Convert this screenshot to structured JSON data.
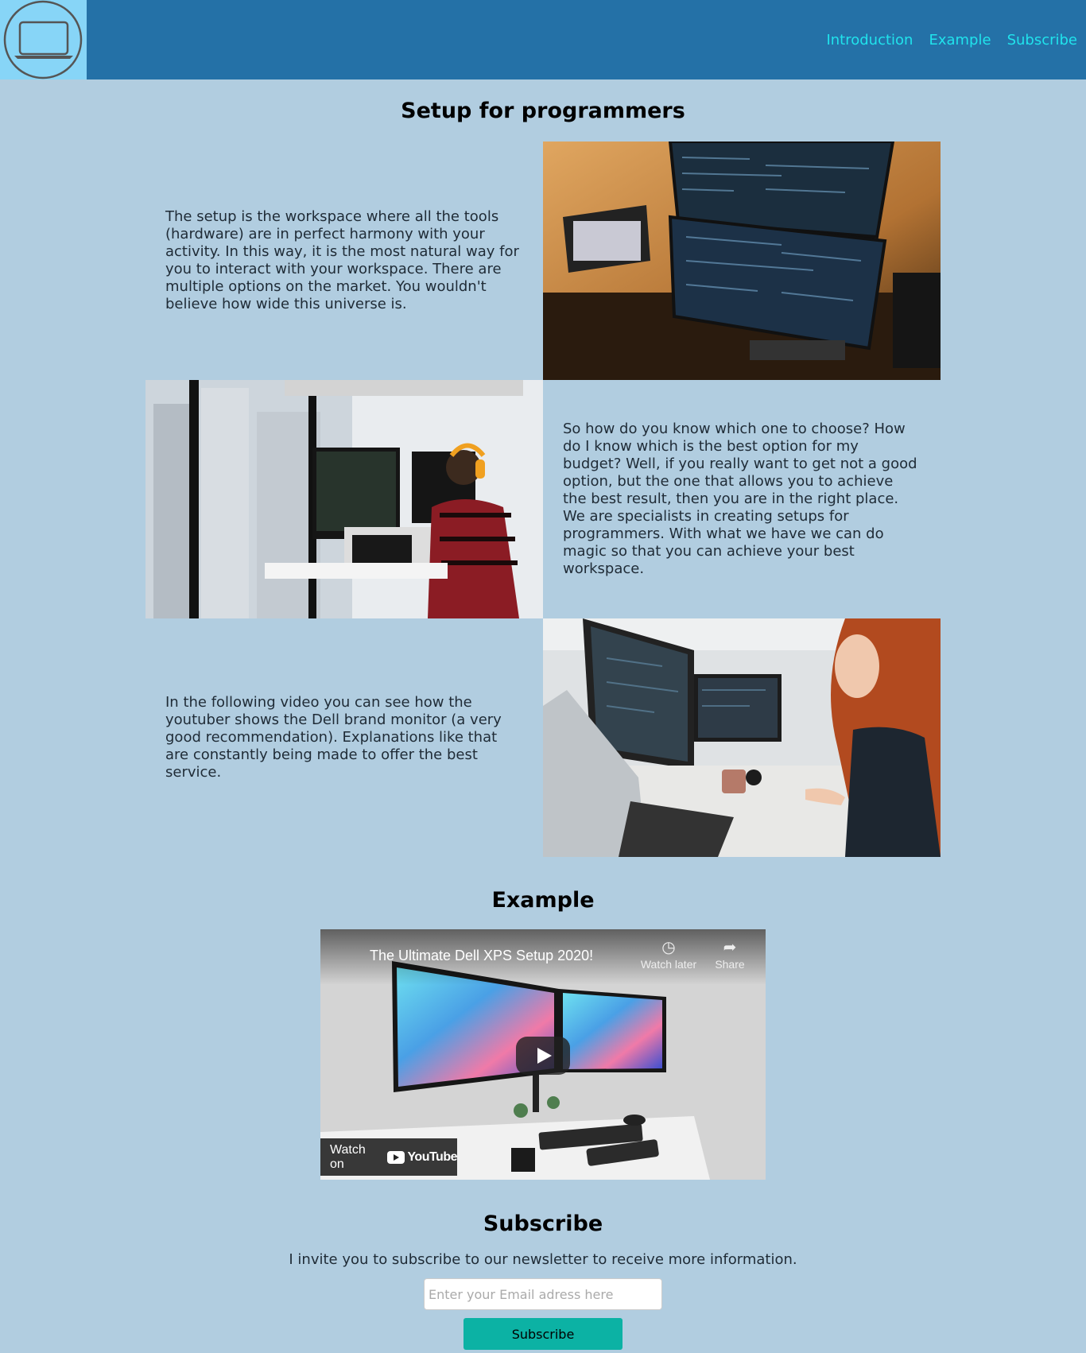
{
  "nav": {
    "logo_icon": "laptop-icon",
    "items": [
      "Introduction",
      "Example",
      "Subscribe"
    ]
  },
  "main": {
    "title": "Setup for programmers",
    "paragraphs": [
      "The setup is the workspace where all the tools (hardware) are in perfect harmony with your activity. In this way, it is the most natural way for you to interact with your workspace. There are multiple options on the market. You wouldn't believe how wide this universe is.",
      "So how do you know which one to choose? How do I know which is the best option for my budget? Well, if you really want to get not a good option, but the one that allows you to achieve the best result, then you are in the right place. We are specialists in creating setups for programmers. With what we have we can do magic so that you can achieve your best workspace.",
      "In the following video you can see how the youtuber shows the Dell brand monitor (a very good recommendation). Explanations like that are constantly being made to offer the best service."
    ]
  },
  "example": {
    "title": "Example",
    "video": {
      "title": "The Ultimate Dell XPS Setup 2020!",
      "watch_later": "Watch later",
      "share": "Share",
      "watch_on": "Watch on",
      "brand": "YouTube"
    }
  },
  "subscribe": {
    "title": "Subscribe",
    "text": "I invite you to subscribe to our newsletter to receive more information.",
    "email_placeholder": "Enter your Email adress here",
    "button": "Subscribe"
  },
  "colors": {
    "header": "#2471a7",
    "logo_bg": "#87d5f7",
    "page_bg": "#b1cde0",
    "nav_link": "#20e3ec",
    "button": "#0cb2a4"
  }
}
